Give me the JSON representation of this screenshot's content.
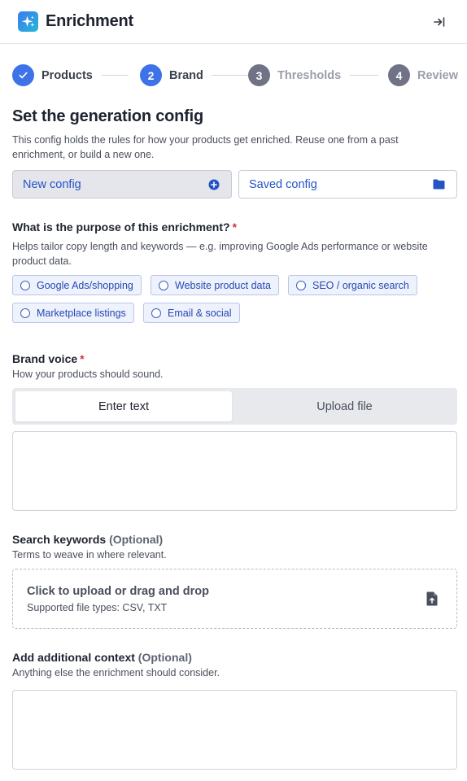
{
  "app": {
    "title": "Enrichment"
  },
  "colors": {
    "accent": "#3d72e8",
    "link": "#2553c7",
    "required": "#d2333f",
    "muted_step": "#6f7385"
  },
  "steps": [
    {
      "label": "Products",
      "number": "1",
      "state": "complete"
    },
    {
      "label": "Brand",
      "number": "2",
      "state": "current"
    },
    {
      "label": "Thresholds",
      "number": "3",
      "state": "upcoming"
    },
    {
      "label": "Review",
      "number": "4",
      "state": "upcoming"
    }
  ],
  "config": {
    "title": "Set the generation config",
    "description": "This config holds the rules for how your products get enriched. Reuse one from a past enrichment, or build a new one.",
    "new_label": "New config",
    "new_icon": "plus-circle-icon",
    "saved_label": "Saved config",
    "saved_icon": "folder-icon"
  },
  "purpose": {
    "label": "What is the purpose of this enrichment?",
    "required_mark": "*",
    "help": "Helps tailor copy length and keywords — e.g. improving Google Ads performance or website product data.",
    "options": [
      "Google Ads/shopping",
      "Website product data",
      "SEO / organic search",
      "Marketplace listings",
      "Email & social"
    ]
  },
  "brand_voice": {
    "label": "Brand voice",
    "required_mark": "*",
    "help": "How your products should sound.",
    "tabs": [
      "Enter text",
      "Upload file"
    ],
    "active_tab": "Enter text",
    "value": ""
  },
  "keywords": {
    "label": "Search keywords",
    "optional": "(Optional)",
    "help": "Terms to weave in where relevant.",
    "upload_title": "Click to upload or drag and drop",
    "upload_sub": "Supported file types: CSV, TXT",
    "upload_icon": "file-upload-icon"
  },
  "context": {
    "label": "Add additional context",
    "optional": "(Optional)",
    "help": "Anything else the enrichment should consider.",
    "value": ""
  }
}
